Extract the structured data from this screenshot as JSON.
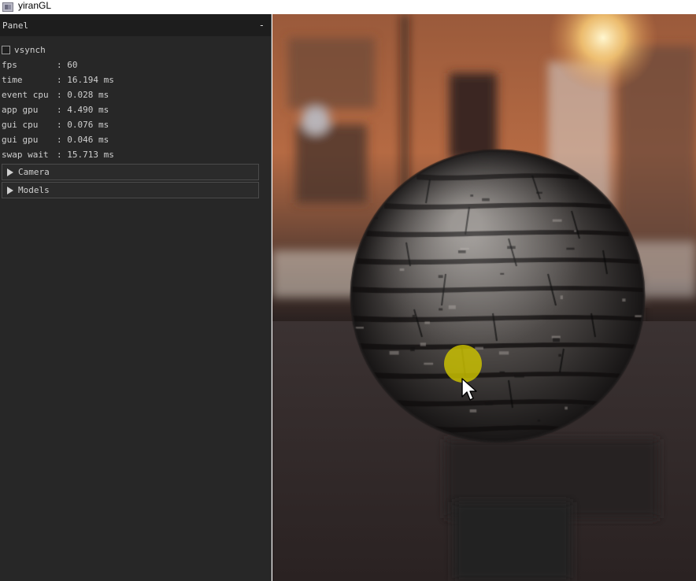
{
  "window": {
    "title": "yiranGL",
    "icon": "app-icon"
  },
  "panel": {
    "title": "Panel",
    "collapse_label": "-",
    "vsync_label": "vsynch",
    "vsync_checked": false,
    "stats": [
      {
        "label": "fps",
        "value": ": 60"
      },
      {
        "label": "time",
        "value": ": 16.194 ms"
      },
      {
        "label": "event cpu",
        "value": ": 0.028 ms"
      },
      {
        "label": "app gpu",
        "value": ": 4.490 ms"
      },
      {
        "label": "gui cpu",
        "value": ": 0.076 ms"
      },
      {
        "label": "gui gpu",
        "value": ": 0.046 ms"
      },
      {
        "label": "swap wait",
        "value": ": 15.713 ms"
      }
    ],
    "sections": [
      {
        "label": "Camera",
        "expanded": false,
        "icon": "triangle-right-icon"
      },
      {
        "label": "Models",
        "expanded": false,
        "icon": "triangle-right-icon"
      }
    ]
  },
  "viewport": {
    "scene": "stone sphere over blurred street background",
    "cursor_highlight_color": "#cdc300",
    "cursor_icon": "mouse-pointer-icon"
  }
}
